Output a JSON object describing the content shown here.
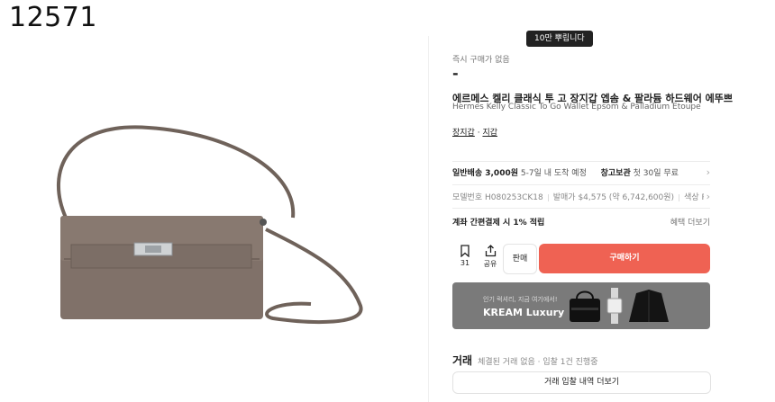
{
  "watermark": "12571",
  "tooltip": "10만 뿌립니다",
  "instant_label": "즉시 구매가 없음",
  "price": "-",
  "title_ko": "에르메스 켈리 클래식 투 고 장지갑 엡솜 & 팔라듐 하드웨어 에뚜쁘",
  "title_en": "Hermes Kelly Classic To Go Wallet Epsom & Palladium Etoupe",
  "category": {
    "item1": "장지갑",
    "sep": " · ",
    "item2": "지갑"
  },
  "shipping": {
    "normal_label": "일반배송 3,000원",
    "normal_desc": "5-7일 내 도착 예정",
    "storage_label": "창고보관",
    "storage_desc": "첫 30일 무료"
  },
  "info": {
    "model": "모델번호 H080253CK18",
    "release": "발매가 $4,575 (약 6,742,600원)",
    "color": "색상 Palladium"
  },
  "payment": {
    "label": "계좌 간편결제 시 1% 적립",
    "benefit": "혜택 더보기"
  },
  "actions": {
    "bookmark_count": "31",
    "share_label": "공유",
    "sell_label": "판매",
    "buy_label": "구매하기"
  },
  "banner": {
    "subtitle": "인기 럭셔리, 지금 여기에서!",
    "title": "KREAM Luxury"
  },
  "trade": {
    "title": "거래",
    "desc": "체결된 거래 없음 · 입찰 1건 진행중",
    "history_button": "거래 입찰 내역 더보기"
  },
  "colors": {
    "accent": "#ef6253",
    "banner_bg": "#7a7a7a",
    "bag": "#7d6d63"
  }
}
